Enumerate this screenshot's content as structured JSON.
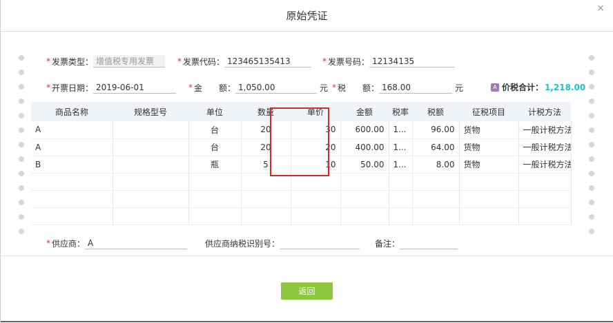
{
  "dialog": {
    "title": "原始凭证",
    "close_glyph": "×"
  },
  "fields": {
    "invoice_type": {
      "label": "发票类型：",
      "value": "增值税专用发票"
    },
    "invoice_code": {
      "label": "发票代码：",
      "value": "123465135413"
    },
    "invoice_number": {
      "label": "发票号码：",
      "value": "12134135"
    },
    "issue_date": {
      "label": "开票日期：",
      "value": "2019-06-01"
    },
    "amount": {
      "label": "金　　额：",
      "value": "1,050.00",
      "unit": "元"
    },
    "tax": {
      "label": "税　　额：",
      "value": "168.00",
      "unit": "元"
    },
    "total": {
      "label": "价税合计：",
      "value": "1,218.00"
    },
    "supplier": {
      "label": "供应商：",
      "value": "A"
    },
    "supplier_tax_id": {
      "label": "供应商纳税识别号：",
      "value": ""
    },
    "remark": {
      "label": "备注：",
      "value": ""
    }
  },
  "table": {
    "headers": [
      "商品名称",
      "规格型号",
      "单位",
      "数量",
      "单价",
      "金额",
      "税率",
      "税额",
      "征税项目",
      "计税方法"
    ],
    "rows": [
      [
        "A",
        "",
        "台",
        "20",
        "30",
        "600.00",
        "1...",
        "96.00",
        "货物",
        "一般计税方法-..."
      ],
      [
        "A",
        "",
        "台",
        "20",
        "20",
        "400.00",
        "1...",
        "64.00",
        "货物",
        "一般计税方法-..."
      ],
      [
        "B",
        "",
        "瓶",
        "5",
        "10",
        "50.00",
        "1...",
        "8.00",
        "货物",
        "一般计税方法-..."
      ]
    ]
  },
  "buttons": {
    "return_label": "返回"
  },
  "colors": {
    "accent_total": "#1ec3c9",
    "button_green": "#8dc63f",
    "highlight_red": "#d42a2a",
    "required": "#e23"
  }
}
